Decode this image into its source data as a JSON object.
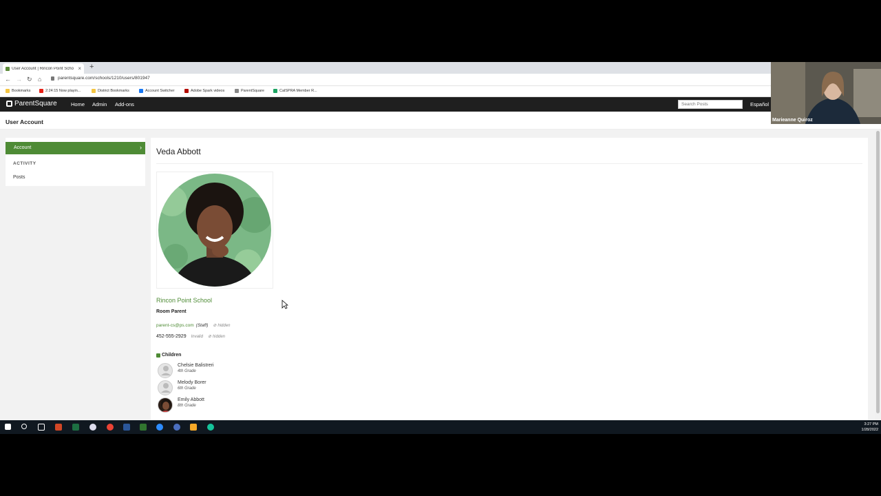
{
  "browser": {
    "tab_title": "User Account | Rincon Point Scho",
    "new_tab": "+",
    "url": "parentsquare.com/schools/1210/users/801947",
    "bookmarks": [
      {
        "label": "Bookmarks",
        "color": "#f4c542"
      },
      {
        "label": "2:24:15 Now playin...",
        "color": "#e62117"
      },
      {
        "label": "District Bookmarks",
        "color": "#f4c542"
      },
      {
        "label": "Account Switcher",
        "color": "#1877f2"
      },
      {
        "label": "Adobe Spark videos",
        "color": "#b30b00"
      },
      {
        "label": "ParentSquare",
        "color": "#888888"
      },
      {
        "label": "CalSPRA Member R...",
        "color": "#1da462"
      }
    ]
  },
  "appnav": {
    "brand": "ParentSquare",
    "links": [
      "Home",
      "Admin",
      "Add-ons"
    ],
    "search_placeholder": "Search Posts",
    "language": "Español"
  },
  "page": {
    "title": "User Account"
  },
  "sidebar": {
    "active_item": "Account",
    "section_heading": "ACTIVITY",
    "items": [
      "Posts"
    ]
  },
  "profile": {
    "name": "Veda Abbott",
    "school": "Rincon Point School",
    "role": "Room Parent",
    "email": "parent-cs@ps.com",
    "email_tag": "(Staff)",
    "hidden_label": "hidden",
    "phone": "452-555-2929",
    "phone_status": "Invalid",
    "phone_hidden_label": "hidden"
  },
  "children": {
    "heading": "Children",
    "list": [
      {
        "name": "Chelsie Balistreri",
        "grade": "4th Grade",
        "photo": "placeholder"
      },
      {
        "name": "Melody Borer",
        "grade": "6th Grade",
        "photo": "placeholder"
      },
      {
        "name": "Emily Abbott",
        "grade": "8th Grade",
        "photo": "photo"
      }
    ]
  },
  "video": {
    "participant": "Marieanne Quiroz"
  },
  "taskbar": {
    "time": "3:27 PM",
    "date": "1/28/2022"
  },
  "colors": {
    "brand_green": "#4e8b35",
    "nav_dark": "#1f1f1f"
  }
}
